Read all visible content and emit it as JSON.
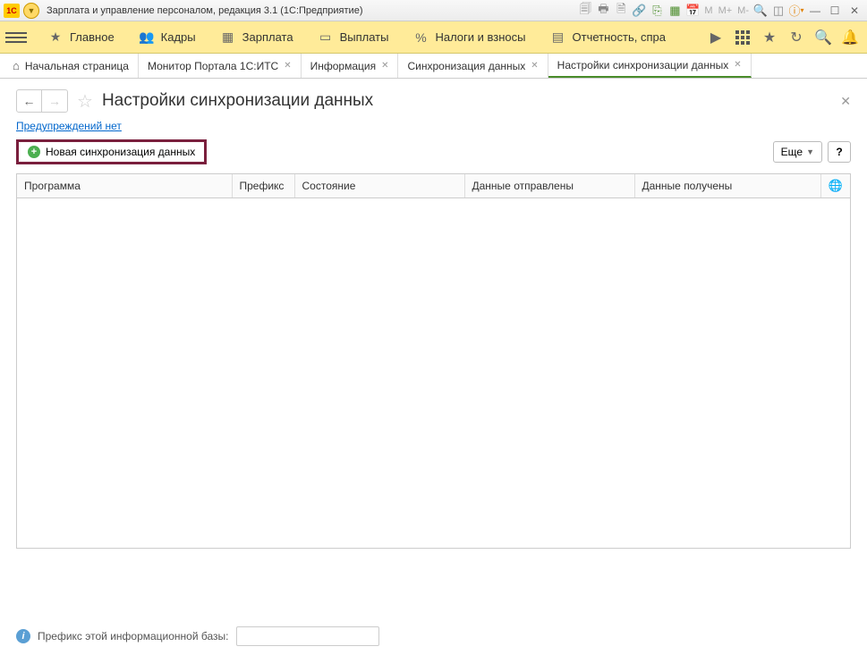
{
  "titlebar": {
    "logo": "1C",
    "title": "Зарплата и управление персоналом, редакция 3.1  (1С:Предприятие)",
    "m_labels": [
      "M",
      "M+",
      "M-"
    ]
  },
  "nav": {
    "items": [
      {
        "label": "Главное"
      },
      {
        "label": "Кадры"
      },
      {
        "label": "Зарплата"
      },
      {
        "label": "Выплаты"
      },
      {
        "label": "Налоги и взносы"
      },
      {
        "label": "Отчетность, спра"
      }
    ]
  },
  "tabs": [
    {
      "label": "Начальная страница",
      "closable": false,
      "home": true
    },
    {
      "label": "Монитор Портала 1С:ИТС",
      "closable": true
    },
    {
      "label": "Информация",
      "closable": true
    },
    {
      "label": "Синхронизация данных",
      "closable": true
    },
    {
      "label": "Настройки синхронизации данных",
      "closable": true,
      "active": true
    }
  ],
  "page": {
    "title": "Настройки синхронизации данных",
    "warnings_link": "Предупреждений нет",
    "new_sync_label": "Новая синхронизация данных",
    "more_label": "Еще",
    "help_label": "?"
  },
  "table": {
    "columns": [
      "Программа",
      "Префикс",
      "Состояние",
      "Данные отправлены",
      "Данные получены"
    ]
  },
  "footer": {
    "label": "Префикс этой информационной базы:",
    "value": ""
  }
}
